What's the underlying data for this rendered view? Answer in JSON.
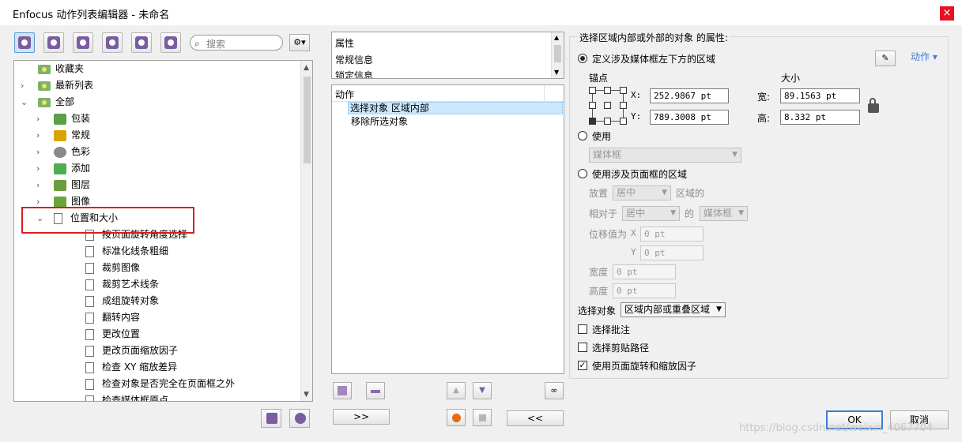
{
  "window": {
    "title": "Enfocus 动作列表编辑器 - 未命名",
    "close": "×"
  },
  "toolbar": {
    "buttons": [
      "favorites-actions-icon",
      "edit-action-icon",
      "refresh-actions-icon",
      "approve-action-icon",
      "info-action-icon",
      "tools-action-icon"
    ],
    "search_placeholder": "搜索",
    "gear_menu": "⚙▾"
  },
  "tree": {
    "items": [
      {
        "label": "收藏夹",
        "arrow": "",
        "icon": "folder"
      },
      {
        "label": "最新列表",
        "arrow": "›",
        "icon": "folder"
      },
      {
        "label": "全部",
        "arrow": "⌄",
        "icon": "folder"
      },
      {
        "label": "包装",
        "arrow": "›",
        "icon": "package"
      },
      {
        "label": "常规",
        "arrow": "›",
        "icon": "crown"
      },
      {
        "label": "色彩",
        "arrow": "›",
        "icon": "palette"
      },
      {
        "label": "添加",
        "arrow": "›",
        "icon": "plus"
      },
      {
        "label": "图层",
        "arrow": "›",
        "icon": "layers"
      },
      {
        "label": "图像",
        "arrow": "›",
        "icon": "image"
      },
      {
        "label": "位置和大小",
        "arrow": "⌄",
        "icon": "doc"
      },
      {
        "label": "按页面旋转角度选择",
        "arrow": "",
        "icon": "doc"
      },
      {
        "label": "标准化线条粗细",
        "arrow": "",
        "icon": "doc"
      },
      {
        "label": "裁剪图像",
        "arrow": "",
        "icon": "doc"
      },
      {
        "label": "裁剪艺术线条",
        "arrow": "",
        "icon": "doc"
      },
      {
        "label": "成组旋转对象",
        "arrow": "",
        "icon": "doc"
      },
      {
        "label": "翻转内容",
        "arrow": "",
        "icon": "doc"
      },
      {
        "label": "更改位置",
        "arrow": "",
        "icon": "doc"
      },
      {
        "label": "更改页面缩放因子",
        "arrow": "",
        "icon": "doc"
      },
      {
        "label": "检查 XY 缩放差异",
        "arrow": "",
        "icon": "doc"
      },
      {
        "label": "检查对象是否完全在页面框之外",
        "arrow": "",
        "icon": "doc"
      },
      {
        "label": "检查媒体框原点",
        "arrow": "",
        "icon": "doc"
      }
    ]
  },
  "props_list": {
    "items": [
      "属性",
      "常规信息",
      "锁定信息"
    ]
  },
  "actions_list": {
    "header": "动作",
    "items": [
      "选择对象 区域内部",
      "移除所选对象"
    ]
  },
  "mid_buttons": {
    "forward": ">>",
    "back": "<<"
  },
  "right": {
    "heading": "选择区域内部或外部的对象 的属性:",
    "actions_link": "动作 ▾",
    "opt1": "定义涉及媒体框左下方的区域",
    "anchor_label": "锚点",
    "size_label": "大小",
    "x_label": "X:",
    "y_label": "Y:",
    "x_value": "252.9867 pt",
    "y_value": "789.3008 pt",
    "width_label": "宽:",
    "height_label": "高:",
    "width_value": "89.1563 pt",
    "height_value": "8.332 pt",
    "opt2": "使用",
    "opt2_select": "媒体框",
    "opt3": "使用涉及页面框的区域",
    "place_label": "放置",
    "place_value": "居中",
    "region_of": "区域的",
    "relative_label": "相对于",
    "relative_value": "居中",
    "of_label": "的",
    "relative_box": "媒体框",
    "offset_label": "位移值为",
    "offset_x_label": "X",
    "offset_y_label": "Y",
    "offset_x": "0 pt",
    "offset_y": "0 pt",
    "w_label": "宽度",
    "w_value": "0 pt",
    "h_label": "高度",
    "h_value": "0 pt",
    "select_label": "选择对象",
    "select_value": "区域内部或重叠区域",
    "cb1": "选择批注",
    "cb2": "选择剪贴路径",
    "cb3": "使用页面旋转和缩放因子",
    "cb3_mark": "✓"
  },
  "footer": {
    "ok": "OK",
    "cancel": "取消",
    "watermark": "https://blog.csdn.net/weixin_4067704"
  },
  "colors": {
    "accent": "#7a5ca0",
    "selection": "#cce8ff",
    "highlight_box": "#d81f1f"
  }
}
